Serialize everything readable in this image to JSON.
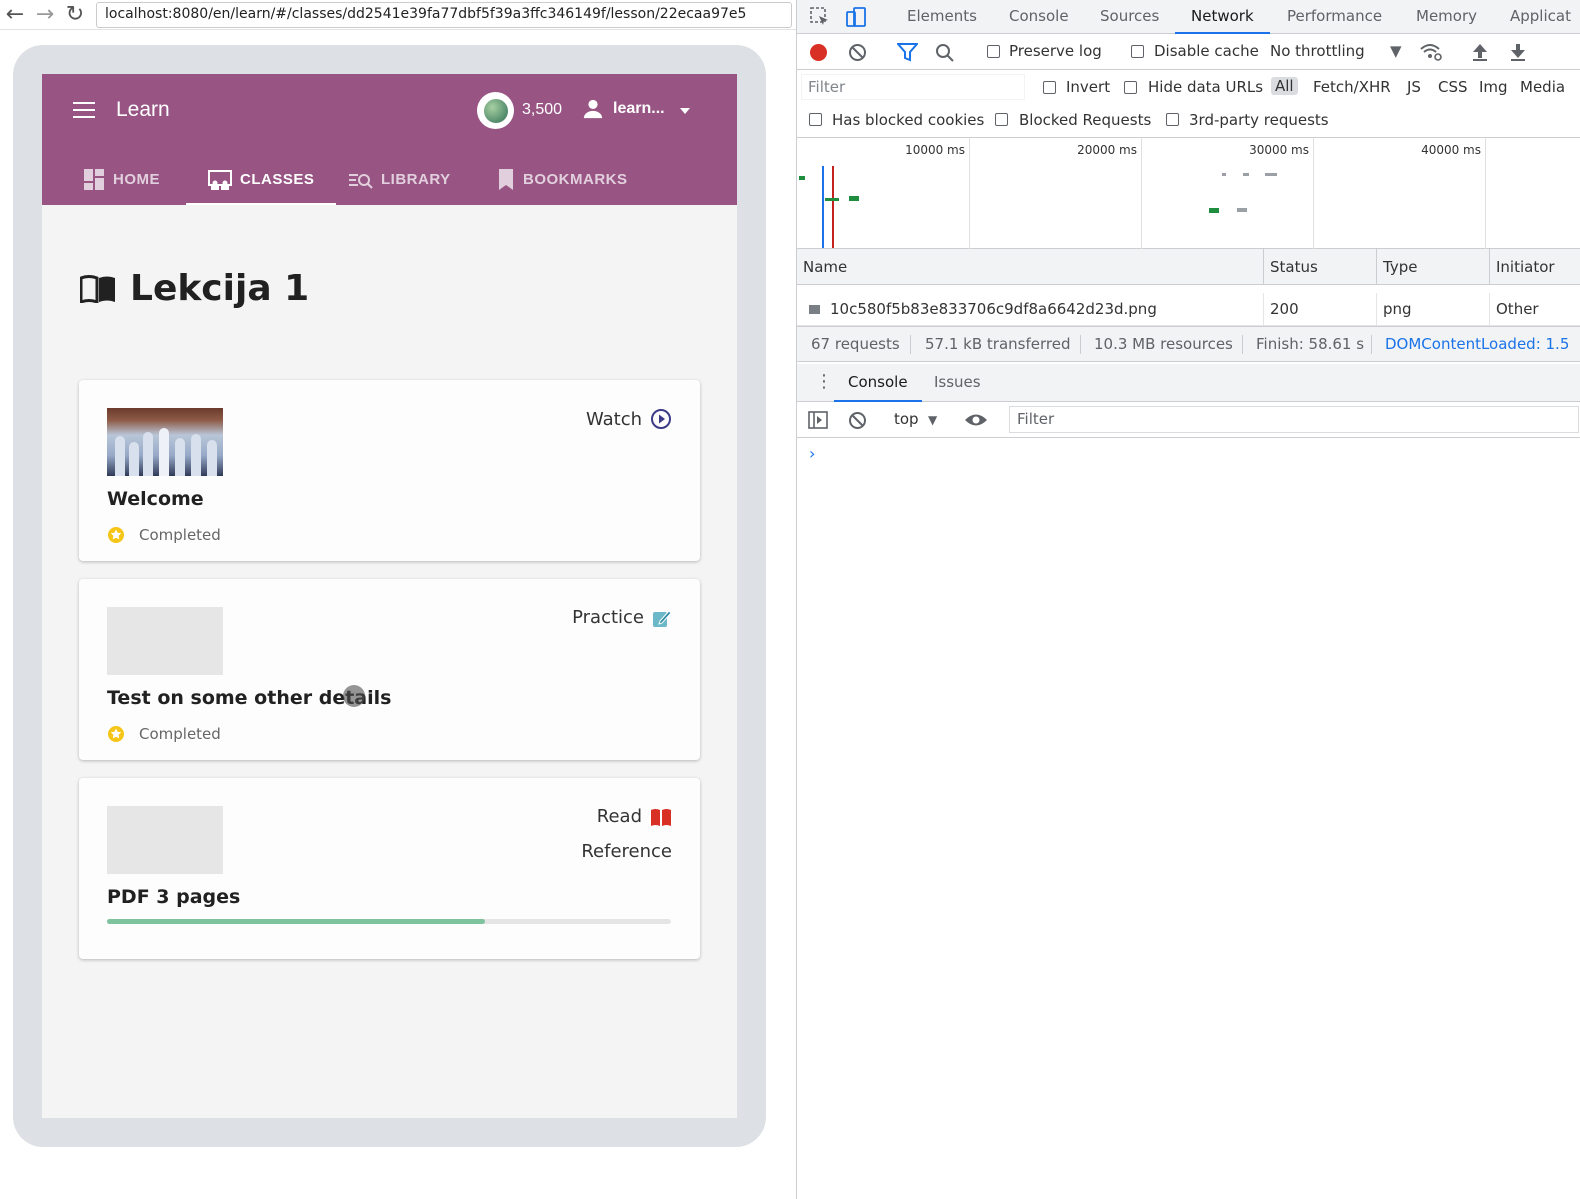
{
  "browser": {
    "url": "localhost:8080/en/learn/#/classes/dd2541e39fa77dbf5f39a3ffc346149f/lesson/22ecaa97e5"
  },
  "app": {
    "title": "Learn",
    "points": "3,500",
    "user": "learn...",
    "tabs": [
      {
        "label": "HOME",
        "icon": "home-grid-icon",
        "active": false
      },
      {
        "label": "CLASSES",
        "icon": "classes-icon",
        "active": true
      },
      {
        "label": "LIBRARY",
        "icon": "library-search-icon",
        "active": false
      },
      {
        "label": "BOOKMARKS",
        "icon": "bookmark-icon",
        "active": false
      }
    ],
    "colors": {
      "appbar": "#985584",
      "completed_star": "#f5c518",
      "progress": "#7ec29e"
    }
  },
  "lesson": {
    "title": "Lekcija 1",
    "resources": [
      {
        "title": "Welcome",
        "kind": "Watch",
        "kind_icon": "play-circle-icon",
        "status": "Completed"
      },
      {
        "title": "Test on some other details",
        "kind": "Practice",
        "kind_icon": "practice-pencil-icon",
        "status": "Completed"
      },
      {
        "title": "PDF 3 pages",
        "kind": "Read",
        "kind_sub": "Reference",
        "kind_icon": "read-book-icon",
        "progress": 0.67
      }
    ]
  },
  "devtools": {
    "tabs": [
      "Elements",
      "Console",
      "Sources",
      "Network",
      "Performance",
      "Memory",
      "Applicat"
    ],
    "active_tab": "Network",
    "toolbar": {
      "preserve_log": "Preserve log",
      "disable_cache": "Disable cache",
      "throttling": "No throttling"
    },
    "filter": {
      "placeholder": "Filter",
      "invert": "Invert",
      "hide_data_urls": "Hide data URLs",
      "types": [
        "All",
        "Fetch/XHR",
        "JS",
        "CSS",
        "Img",
        "Media"
      ]
    },
    "options": {
      "blocked_cookies": "Has blocked cookies",
      "blocked_requests": "Blocked Requests",
      "third_party": "3rd-party requests"
    },
    "timeline_labels": [
      "10000 ms",
      "20000 ms",
      "30000 ms",
      "40000 ms"
    ],
    "columns": [
      "Name",
      "Status",
      "Type",
      "Initiator"
    ],
    "request": {
      "name": "10c580f5b83e833706c9df8a6642d23d.png",
      "status": "200",
      "type": "png",
      "initiator": "Other"
    },
    "summary": {
      "requests": "67 requests",
      "transferred": "57.1 kB transferred",
      "resources": "10.3 MB resources",
      "finish": "Finish: 58.61 s",
      "dcl": "DOMContentLoaded: 1.5"
    },
    "drawer_tabs": [
      "Console",
      "Issues"
    ],
    "console": {
      "context": "top",
      "filter_placeholder": "Filter",
      "prompt": "›"
    }
  }
}
